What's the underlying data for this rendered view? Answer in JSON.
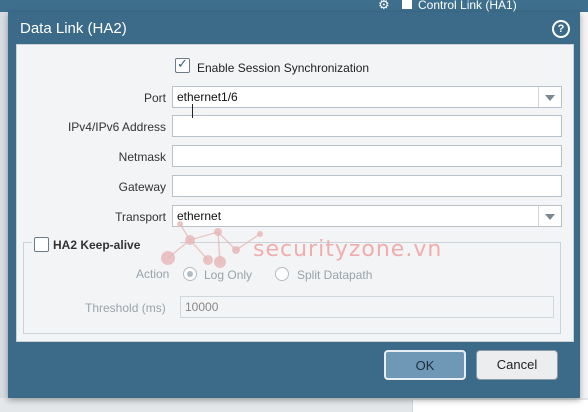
{
  "background": {
    "top_right_title": "Control Link (HA1)"
  },
  "dialog": {
    "title": "Data Link (HA2)",
    "help_icon": "question-circle-icon",
    "enable_session_sync": {
      "label": "Enable Session Synchronization",
      "checked": true
    },
    "fields": {
      "port": {
        "label": "Port",
        "value": "ethernet1/6"
      },
      "ip_address": {
        "label": "IPv4/IPv6 Address",
        "value": ""
      },
      "netmask": {
        "label": "Netmask",
        "value": ""
      },
      "gateway": {
        "label": "Gateway",
        "value": ""
      },
      "transport": {
        "label": "Transport",
        "value": "ethernet"
      }
    },
    "keep_alive": {
      "label": "HA2 Keep-alive",
      "checked": false,
      "action_label": "Action",
      "options": [
        "Log Only",
        "Split Datapath"
      ],
      "selected_option": "Log Only",
      "threshold_label": "Threshold (ms)",
      "threshold_value": "10000"
    },
    "buttons": {
      "ok": "OK",
      "cancel": "Cancel"
    }
  },
  "watermark": {
    "text": "securityzone.vn"
  },
  "colors": {
    "dialog_header": "#3b6b88",
    "ok_button": "#6f98b7",
    "watermark": "#f0a6a6"
  }
}
